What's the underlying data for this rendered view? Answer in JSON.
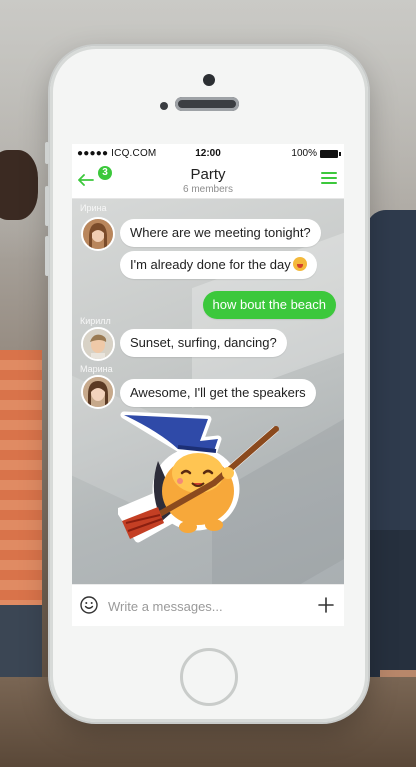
{
  "status_bar": {
    "carrier": "●●●●● ICQ.COM",
    "time": "12:00",
    "battery": "100%"
  },
  "header": {
    "title": "Party",
    "subtitle": "6 members",
    "unread_badge": "3",
    "back_icon": "back-arrow-icon",
    "menu_icon": "hamburger-menu-icon",
    "accent_color": "#3cc83c"
  },
  "messages": [
    {
      "sender": "Ирина",
      "text": "Where are we meeting tonight?",
      "direction": "in"
    },
    {
      "sender": "",
      "text": "I'm already done for the day",
      "direction": "in",
      "emoji": "smile-emoji"
    },
    {
      "sender": "",
      "text": "how bout the beach",
      "direction": "out"
    },
    {
      "sender": "Кирилл",
      "text": "Sunset, surfing, dancing?",
      "direction": "in"
    },
    {
      "sender": "Марина",
      "text": "Awesome, I'll get the speakers",
      "direction": "in"
    }
  ],
  "sticker": "witch-cat-on-broom-sticker",
  "composer": {
    "placeholder": "Write a messages...",
    "emoji_icon": "smiley-icon",
    "add_icon": "plus-icon"
  }
}
